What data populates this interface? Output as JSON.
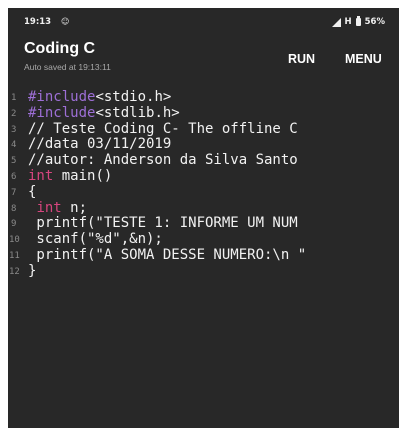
{
  "status_bar": {
    "time": "19:13",
    "notification_icon": "notification-icon",
    "network": "H",
    "battery": "56%"
  },
  "toolbar": {
    "title": "Coding C",
    "subtitle": "Auto saved at 19:13:11",
    "run_label": "RUN",
    "menu_label": "MENU"
  },
  "editor": {
    "line_numbers": [
      "1",
      "2",
      "3",
      "4",
      "5",
      "6",
      "7",
      "8",
      "9",
      "10",
      "11",
      "12"
    ],
    "lines": [
      {
        "parts": [
          {
            "t": "#include",
            "c": "pp"
          },
          {
            "t": "<stdio.h>",
            "c": ""
          }
        ]
      },
      {
        "parts": [
          {
            "t": "#include",
            "c": "pp"
          },
          {
            "t": "<stdlib.h>",
            "c": ""
          }
        ]
      },
      {
        "parts": [
          {
            "t": "// Teste Coding C- The offline C",
            "c": ""
          }
        ]
      },
      {
        "parts": [
          {
            "t": "//data 03/11/2019",
            "c": ""
          }
        ]
      },
      {
        "parts": [
          {
            "t": "//autor: Anderson da Silva Santo",
            "c": ""
          }
        ]
      },
      {
        "parts": [
          {
            "t": "int",
            "c": "type"
          },
          {
            "t": " main()",
            "c": ""
          }
        ]
      },
      {
        "parts": [
          {
            "t": "{",
            "c": ""
          }
        ]
      },
      {
        "parts": [
          {
            "t": " ",
            "c": ""
          },
          {
            "t": "int",
            "c": "type"
          },
          {
            "t": " n;",
            "c": ""
          }
        ]
      },
      {
        "parts": [
          {
            "t": " printf(\"TESTE 1: INFORME UM NUM",
            "c": ""
          }
        ]
      },
      {
        "parts": [
          {
            "t": " scanf(\"%d\",&n);",
            "c": ""
          }
        ]
      },
      {
        "parts": [
          {
            "t": " printf(\"A SOMA DESSE NUMERO:\\n \"",
            "c": ""
          }
        ]
      },
      {
        "parts": [
          {
            "t": "}",
            "c": ""
          }
        ]
      }
    ]
  },
  "colors": {
    "background": "#282828",
    "preprocessor": "#9d6fd6",
    "type_keyword": "#d6457e",
    "text": "#f2f2f2",
    "line_number": "#8a8a8a"
  }
}
